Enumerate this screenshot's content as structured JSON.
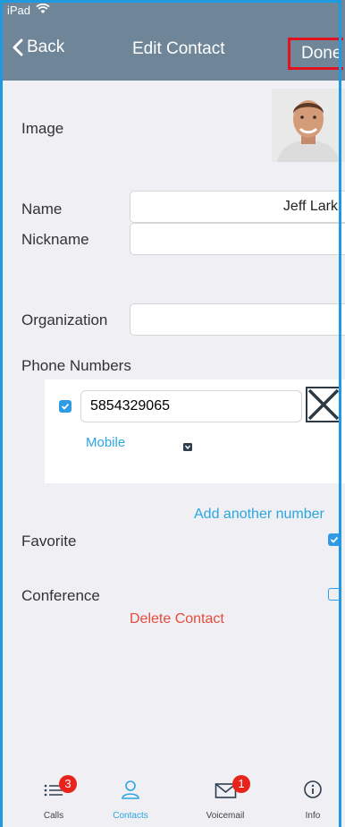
{
  "status_bar": {
    "carrier": "iPad"
  },
  "nav": {
    "back_label": "Back",
    "title": "Edit Contact",
    "done_label": "Done"
  },
  "form": {
    "image_label": "Image",
    "name_label": "Name",
    "name_value": "Jeff Lark",
    "nickname_label": "Nickname",
    "nickname_value": "",
    "organization_label": "Organization",
    "organization_value": "",
    "phone_numbers_label": "Phone Numbers"
  },
  "phone_entries": [
    {
      "number": "5854329065",
      "type": "Mobile",
      "checked": true
    }
  ],
  "add_number_label": "Add another number",
  "favorite": {
    "label": "Favorite",
    "checked": true
  },
  "conference": {
    "label": "Conference",
    "checked": false
  },
  "delete_label": "Delete Contact",
  "tabs": [
    {
      "label": "Calls",
      "icon": "list-icon",
      "badge": "3"
    },
    {
      "label": "Contacts",
      "icon": "person-icon",
      "badge": ""
    },
    {
      "label": "Voicemail",
      "icon": "envelope-icon",
      "badge": "1"
    },
    {
      "label": "Info",
      "icon": "info-icon",
      "badge": ""
    }
  ],
  "colors": {
    "nav_bg": "#6f8699",
    "accent": "#2aa6e0",
    "delete": "#e64b3c",
    "badge": "#e8231c",
    "done_highlight": "#e0141e"
  }
}
